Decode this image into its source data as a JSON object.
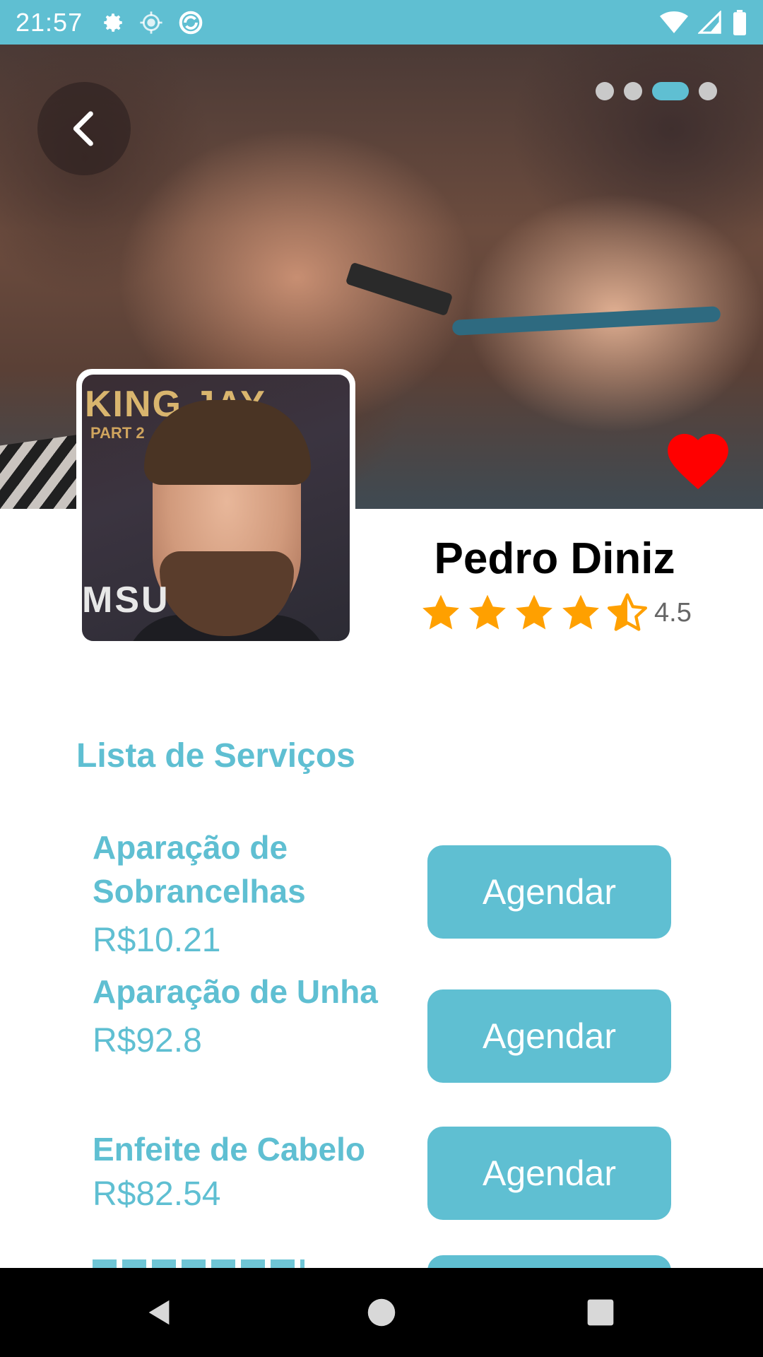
{
  "status_bar": {
    "time": "21:57",
    "icons_left": [
      "settings-gear-icon",
      "location-icon",
      "sync-icon"
    ],
    "icons_right": [
      "wifi-icon",
      "signal-icon",
      "battery-icon"
    ]
  },
  "hero": {
    "carousel_pages": 4,
    "active_page": 3,
    "favorite": true,
    "colors": {
      "accent": "#5fbfd2",
      "heart": "#ff0000"
    }
  },
  "poster": {
    "top_text": "KING JAY",
    "sub_text": "PART 2",
    "bottom_text": "MSU"
  },
  "profile": {
    "name": "Pedro Diniz",
    "rating": 4.5,
    "rating_label": "4.5",
    "stars_max": 5
  },
  "services": {
    "title": "Lista de Serviços",
    "items": [
      {
        "name": "Aparação de Sobrancelhas",
        "price": "R$10.21",
        "button": "Agendar"
      },
      {
        "name": "Aparação de Unha",
        "price": "R$92.8",
        "button": "Agendar"
      },
      {
        "name": "Enfeite de Cabelo",
        "price": "R$82.54",
        "button": "Agendar"
      }
    ]
  },
  "nav": {
    "buttons": [
      "back-triangle-icon",
      "home-circle-icon",
      "recents-square-icon"
    ]
  }
}
